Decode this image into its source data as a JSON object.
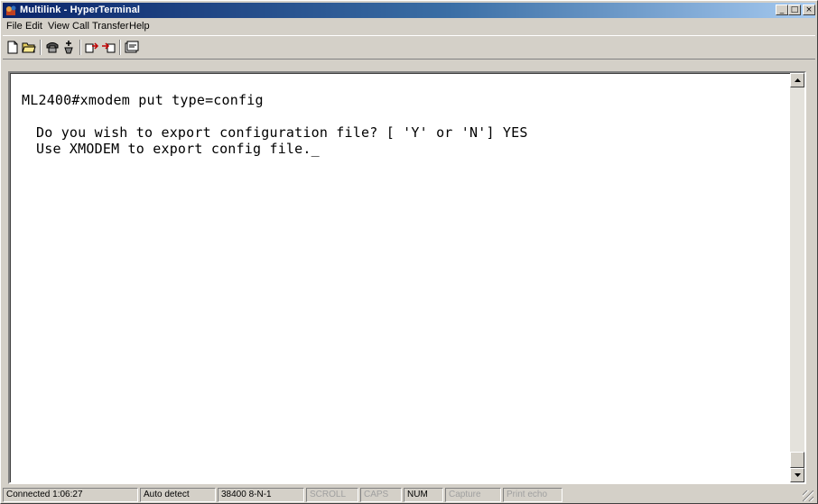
{
  "window": {
    "title": "Multilink - HyperTerminal"
  },
  "controls": {
    "minimize": "_",
    "maximize": "□",
    "close": "×"
  },
  "menu": [
    "File",
    "Edit",
    "View",
    "Call",
    "Transfer",
    "Help"
  ],
  "toolbar": {
    "buttons": [
      "new-document-icon",
      "open-folder-icon",
      "call-phone-icon",
      "disconnect-icon",
      "send-file-icon",
      "receive-file-icon",
      "properties-icon"
    ]
  },
  "terminal": {
    "lines": [
      "ML2400#xmodem put type=config",
      "",
      "Do you wish to export configuration file? [ 'Y' or 'N'] YES",
      "Use XMODEM to export config file._"
    ]
  },
  "status": {
    "connected": "Connected 1:06:27",
    "detect": "Auto detect",
    "settings": "38400 8-N-1",
    "scroll": "SCROLL",
    "caps": "CAPS",
    "num": "NUM",
    "capture": "Capture",
    "print_echo": "Print echo"
  }
}
